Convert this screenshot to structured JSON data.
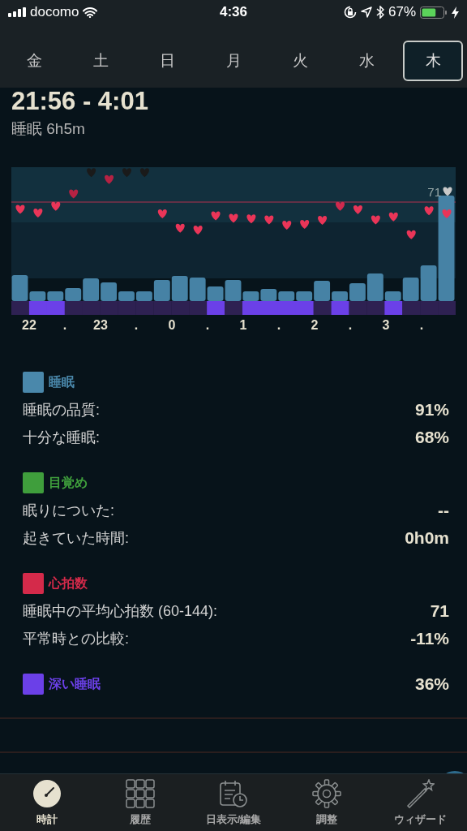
{
  "status_bar": {
    "carrier": "docomo",
    "time": "4:36",
    "battery": "67%"
  },
  "day_tabs": [
    {
      "label": "金",
      "selected": false
    },
    {
      "label": "土",
      "selected": false
    },
    {
      "label": "日",
      "selected": false
    },
    {
      "label": "月",
      "selected": false
    },
    {
      "label": "火",
      "selected": false
    },
    {
      "label": "水",
      "selected": false
    },
    {
      "label": "木",
      "selected": true
    }
  ],
  "sleep": {
    "time_range": "21:56 - 4:01",
    "duration": "睡眠 6h5m"
  },
  "chart": {
    "heart_rate": "71",
    "x_labels": [
      "22",
      ".",
      "23",
      ".",
      "0",
      ".",
      "1",
      ".",
      "2",
      ".",
      "3",
      "."
    ]
  },
  "summary": [
    {
      "title": "睡眠",
      "color": "#4a88ab",
      "rows": [
        {
          "label": "睡眠の品質:",
          "value": "91%"
        },
        {
          "label": "十分な睡眠:",
          "value": "68%"
        }
      ]
    },
    {
      "title": "目覚め",
      "color": "#3f9e3c",
      "rows": [
        {
          "label": "眠りについた:",
          "value": "--"
        },
        {
          "label": "起きていた時間:",
          "value": "0h0m"
        }
      ]
    },
    {
      "title": "心拍数",
      "color": "#d42a4a",
      "rows": [
        {
          "label": "睡眠中の平均心拍数 (60-144):",
          "value": "71"
        },
        {
          "label": "平常時との比較:",
          "value": "-11%"
        }
      ]
    },
    {
      "title": "深い睡眠",
      "color": "#6b40e8",
      "value": "36%"
    }
  ],
  "tab_bar": [
    {
      "label": "時計",
      "selected": true
    },
    {
      "label": "履歴",
      "selected": false
    },
    {
      "label": "日表示/編集",
      "selected": false
    },
    {
      "label": "調整",
      "selected": false
    },
    {
      "label": "ウィザード",
      "selected": false
    }
  ]
}
